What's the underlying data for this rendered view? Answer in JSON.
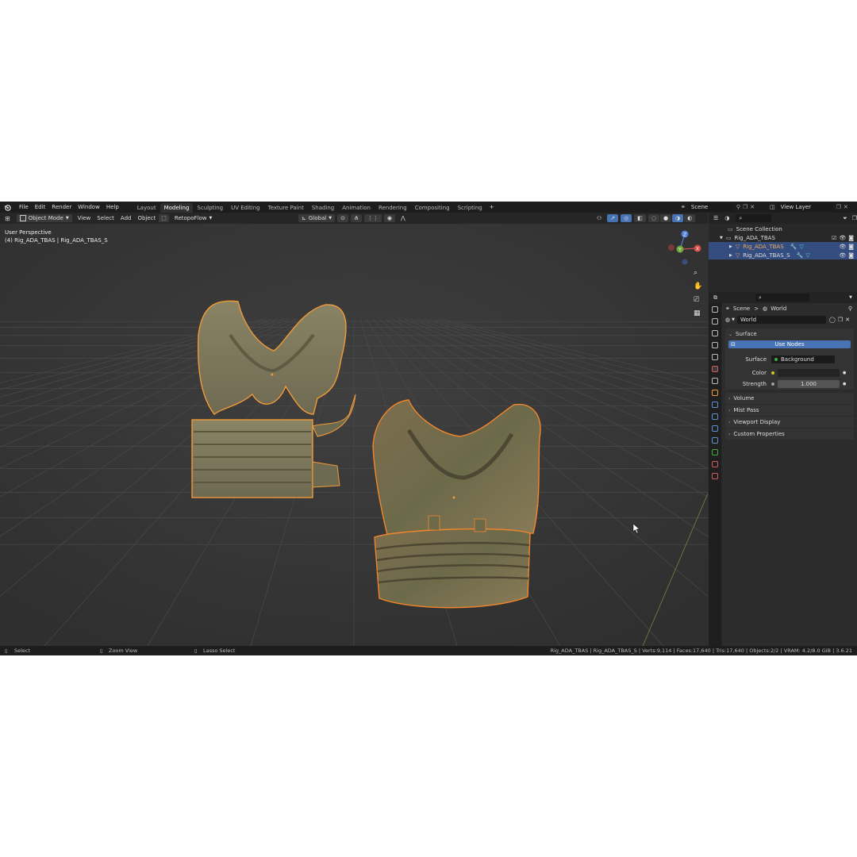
{
  "menu": [
    "File",
    "Edit",
    "Render",
    "Window",
    "Help"
  ],
  "workspaces": [
    {
      "label": "Layout",
      "active": false
    },
    {
      "label": "Modeling",
      "active": true
    },
    {
      "label": "Sculpting",
      "active": false
    },
    {
      "label": "UV Editing",
      "active": false
    },
    {
      "label": "Texture Paint",
      "active": false
    },
    {
      "label": "Shading",
      "active": false
    },
    {
      "label": "Animation",
      "active": false
    },
    {
      "label": "Rendering",
      "active": false
    },
    {
      "label": "Compositing",
      "active": false
    },
    {
      "label": "Scripting",
      "active": false
    }
  ],
  "add_workspace": "+",
  "scene_field": "Scene",
  "view_layer_field": "View Layer",
  "header": {
    "mode": "Object Mode",
    "items": [
      "View",
      "Select",
      "Add",
      "Object"
    ],
    "addon": "RetopoFlow",
    "transform": "Global"
  },
  "viewport": {
    "perspective": "User Perspective",
    "selection": "(4) Rig_ADA_TBAS | Rig_ADA_TBAS_S",
    "gizmo_x": "X",
    "gizmo_y": "Y",
    "gizmo_z": "Z"
  },
  "outliner": {
    "root": "Scene Collection",
    "collection": "Rig_ADA_TBAS",
    "objects": [
      {
        "name": "Rig_ADA_TBAS",
        "selected": true,
        "active": true
      },
      {
        "name": "Rig_ADA_TBAS_S",
        "selected": true,
        "active": false
      }
    ]
  },
  "properties": {
    "breadcrumb_scene": "Scene",
    "breadcrumb_sep": ">",
    "breadcrumb_world": "World",
    "world_name": "World",
    "surface_section": "Surface",
    "use_nodes": "Use Nodes",
    "surface_label": "Surface",
    "surface_value": "Background",
    "color_label": "Color",
    "strength_label": "Strength",
    "strength_value": "1.000",
    "collapsed_sections": [
      "Volume",
      "Mist Pass",
      "Viewport Display",
      "Custom Properties"
    ]
  },
  "statusbar": {
    "select": "Select",
    "zoom": "Zoom View",
    "lasso": "Lasso Select",
    "stats": "Rig_ADA_TBAS | Rig_ADA_TBAS_S | Verts:9,114 | Faces:17,640 | Tris:17,640 | Objects:2/2 | VRAM: 4.2/8.0 GiB | 3.6.21"
  },
  "colors": {
    "accent": "#4772b3",
    "selection_outline": "#f29a38",
    "active_outline": "#ffb060"
  }
}
